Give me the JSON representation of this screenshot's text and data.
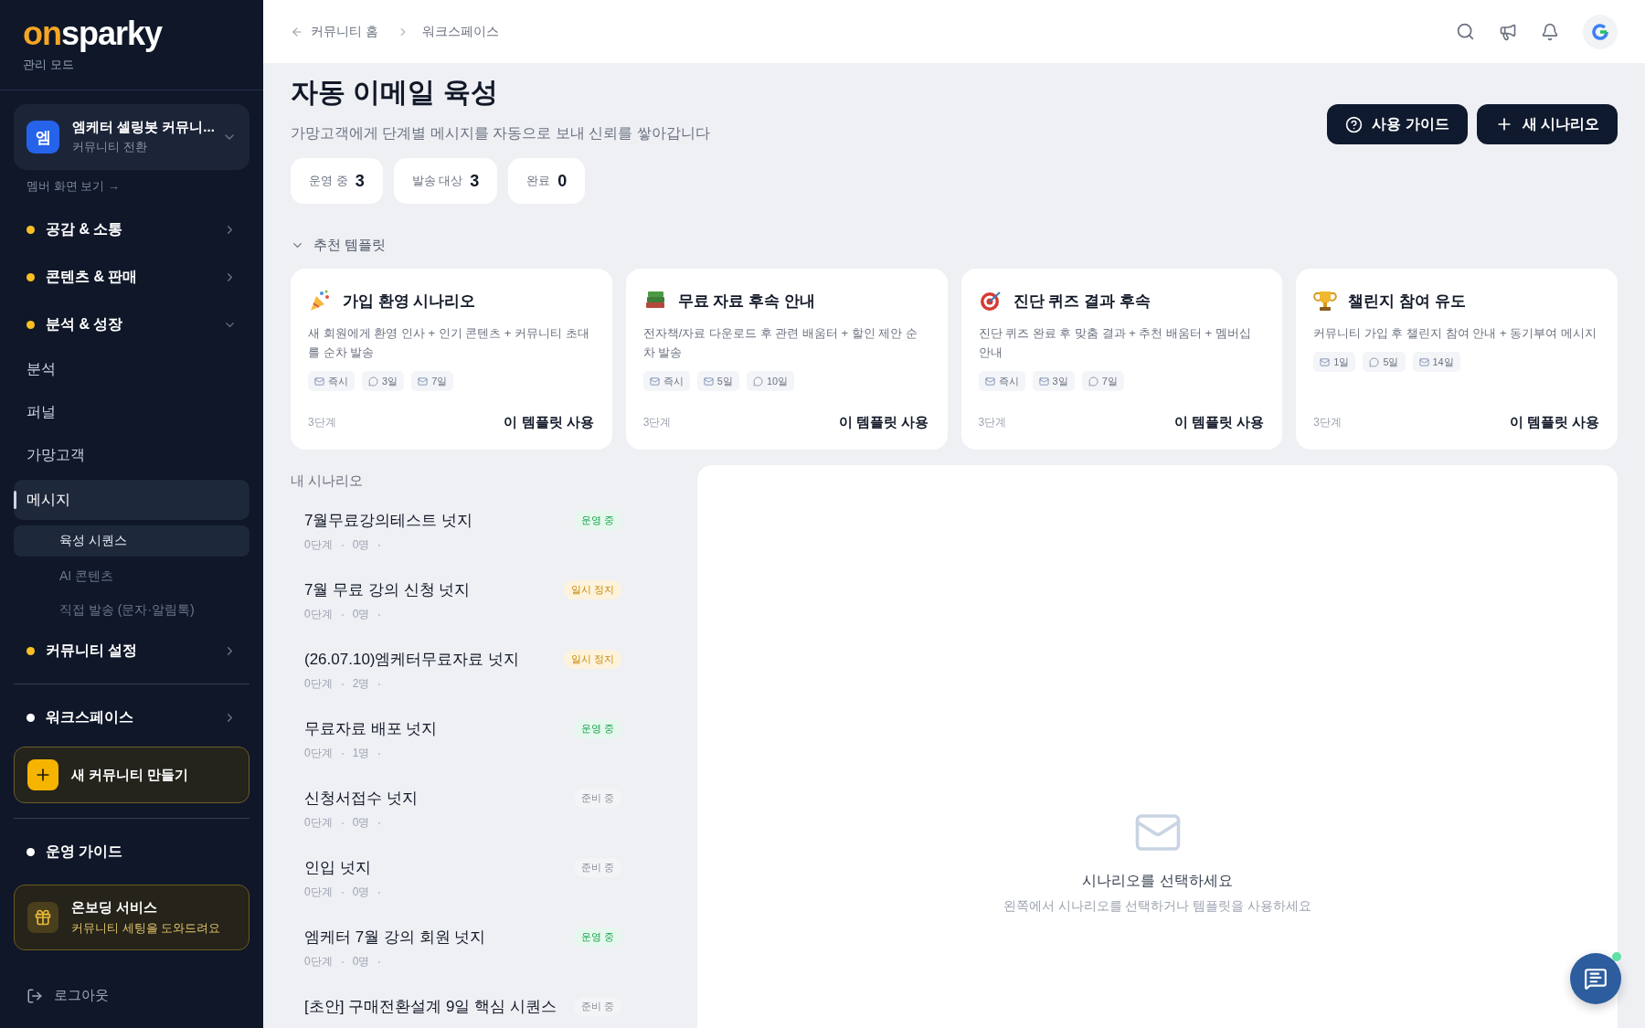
{
  "sidebar": {
    "logo": {
      "on": "on",
      "rest": "sparky"
    },
    "mode": "관리 모드",
    "community": {
      "badge": "엠",
      "name": "엠케터 셀링봇 커뮤니...",
      "sub": "커뮤니티 전환"
    },
    "member_view": "멤버 화면 보기 →",
    "groups": [
      {
        "label": "공감 & 소통",
        "color": "#fbbf24",
        "expanded": false
      },
      {
        "label": "콘텐츠 & 판매",
        "color": "#fbbf24",
        "expanded": false
      },
      {
        "label": "분석 & 성장",
        "color": "#fbbf24",
        "expanded": true,
        "children": [
          {
            "label": "분석",
            "selected": false
          },
          {
            "label": "퍼널",
            "selected": false
          },
          {
            "label": "가망고객",
            "selected": false
          },
          {
            "label": "메시지",
            "selected": true,
            "children": [
              {
                "label": "육성 시퀀스",
                "selected": true
              },
              {
                "label": "AI 콘텐츠",
                "selected": false
              },
              {
                "label": "직접 발송 (문자·알림톡)",
                "selected": false
              }
            ]
          }
        ]
      },
      {
        "label": "커뮤니티 설정",
        "color": "#fbbf24",
        "expanded": false
      }
    ],
    "workspace": {
      "label": "워크스페이스",
      "color": "#ffffff",
      "expanded": false
    },
    "new_community": "새 커뮤니티 만들기",
    "guide": {
      "label": "운영 가이드",
      "color": "#ffffff"
    },
    "onboarding": {
      "title": "온보딩 서비스",
      "sub": "커뮤니티 세팅을 도와드려요"
    },
    "logout": "로그아웃"
  },
  "header": {
    "breadcrumb": [
      "커뮤니티 홈",
      "워크스페이스"
    ]
  },
  "page": {
    "title": "자동 이메일 육성",
    "subtitle": "가망고객에게 단계별 메시지를 자동으로 보내 신뢰를 쌓아갑니다",
    "buttons": [
      {
        "kind": "guide",
        "label": "사용 가이드"
      },
      {
        "kind": "new",
        "label": "새 시나리오"
      }
    ],
    "stats": [
      {
        "label": "운영 중",
        "value": "3"
      },
      {
        "label": "발송 대상",
        "value": "3"
      },
      {
        "label": "완료",
        "value": "0"
      }
    ]
  },
  "templates": {
    "title": "추천 템플릿",
    "expanded": true,
    "items": [
      {
        "kind": "party",
        "title": "가입 환영 시나리오",
        "description": "새 회원에게 환영 인사 + 인기 콘텐츠 + 커뮤니티 초대를 순차 발송",
        "tags": [
          {
            "kind": "email",
            "label": "즉시"
          },
          {
            "kind": "chat",
            "label": "3일"
          },
          {
            "kind": "email",
            "label": "7일"
          }
        ],
        "steps": "3단계",
        "action": "이 템플릿 사용"
      },
      {
        "kind": "books",
        "title": "무료 자료 후속 안내",
        "description": "전자책/자료 다운로드 후 관련 배움터 + 할인 제안 순차 발송",
        "tags": [
          {
            "kind": "email",
            "label": "즉시"
          },
          {
            "kind": "email",
            "label": "5일"
          },
          {
            "kind": "chat",
            "label": "10일"
          }
        ],
        "steps": "3단계",
        "action": "이 템플릿 사용"
      },
      {
        "kind": "target",
        "title": "진단 퀴즈 결과 후속",
        "description": "진단 퀴즈 완료 후 맞춤 결과 + 추천 배움터 + 멤버십 안내",
        "tags": [
          {
            "kind": "email",
            "label": "즉시"
          },
          {
            "kind": "email",
            "label": "3일"
          },
          {
            "kind": "chat",
            "label": "7일"
          }
        ],
        "steps": "3단계",
        "action": "이 템플릿 사용"
      },
      {
        "kind": "trophy",
        "title": "챌린지 참여 유도",
        "description": "커뮤니티 가입 후 챌린지 참여 안내 + 동기부여 메시지",
        "tags": [
          {
            "kind": "email",
            "label": "1일"
          },
          {
            "kind": "chat",
            "label": "5일"
          },
          {
            "kind": "email",
            "label": "14일"
          }
        ],
        "steps": "3단계",
        "action": "이 템플릿 사용"
      }
    ]
  },
  "scenarios": {
    "title": "내 시나리오",
    "items": [
      {
        "name": "7월무료강의테스트 넛지",
        "steps": "0단계",
        "people": "0명",
        "status": {
          "kind": "running",
          "label": "운영 중"
        }
      },
      {
        "name": "7월 무료 강의 신청 넛지",
        "steps": "0단계",
        "people": "0명",
        "status": {
          "kind": "paused",
          "label": "일시 정지"
        }
      },
      {
        "name": "(26.07.10)엠케터무료자료 넛지",
        "steps": "0단계",
        "people": "2명",
        "status": {
          "kind": "paused",
          "label": "일시 정지"
        }
      },
      {
        "name": "무료자료 배포 넛지",
        "steps": "0단계",
        "people": "1명",
        "status": {
          "kind": "running",
          "label": "운영 중"
        }
      },
      {
        "name": "신청서접수 넛지",
        "steps": "0단계",
        "people": "0명",
        "status": {
          "kind": "ready",
          "label": "준비 중"
        }
      },
      {
        "name": "인입 넛지",
        "steps": "0단계",
        "people": "0명",
        "status": {
          "kind": "ready",
          "label": "준비 중"
        }
      },
      {
        "name": "엠케터 7월 강의 회원 넛지",
        "steps": "0단계",
        "people": "0명",
        "status": {
          "kind": "running",
          "label": "운영 중"
        }
      },
      {
        "name": "[초안] 구매전환설계 9일 핵심 시퀀스",
        "status": {
          "kind": "ready",
          "label": "준비 중"
        }
      }
    ]
  },
  "detail": {
    "title": "시나리오를 선택하세요",
    "hint": "왼쪽에서 시나리오를 선택하거나 템플릿을 사용하세요"
  }
}
